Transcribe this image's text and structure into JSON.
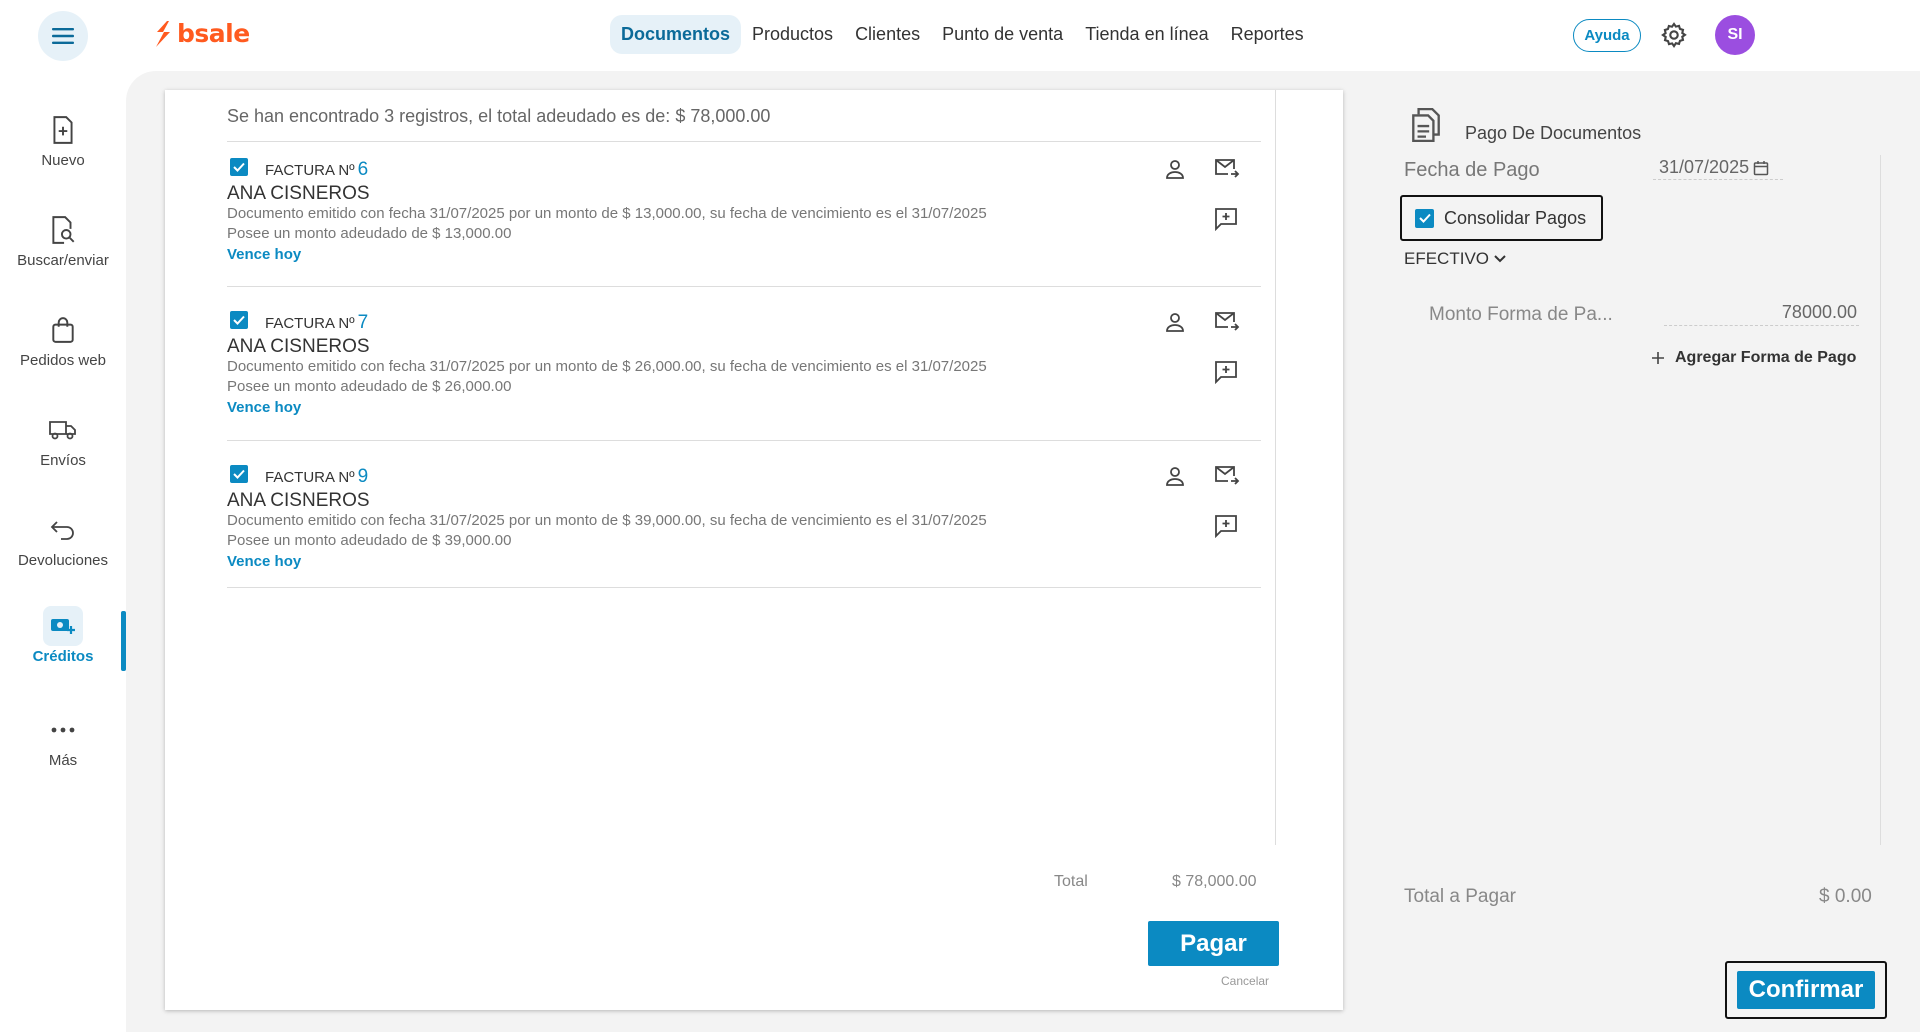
{
  "app": {
    "logo_text": "bsale",
    "brand_color": "#ff5a1f",
    "accent_color": "#0b8ac2"
  },
  "topnav": {
    "items": [
      {
        "label": "Documentos",
        "active": true
      },
      {
        "label": "Productos"
      },
      {
        "label": "Clientes"
      },
      {
        "label": "Punto de venta"
      },
      {
        "label": "Tienda en línea"
      },
      {
        "label": "Reportes"
      }
    ],
    "help_label": "Ayuda",
    "avatar_initials": "SI"
  },
  "sidebar": {
    "items": [
      {
        "label": "Nuevo",
        "icon": "file-plus-icon"
      },
      {
        "label": "Buscar/enviar",
        "icon": "file-search-icon"
      },
      {
        "label": "Pedidos web",
        "icon": "shopping-bag-icon"
      },
      {
        "label": "Envíos",
        "icon": "truck-icon"
      },
      {
        "label": "Devoluciones",
        "icon": "undo-icon"
      },
      {
        "label": "Créditos",
        "icon": "cash-plus-icon",
        "active": true
      },
      {
        "label": "Más",
        "icon": "more-dots-icon"
      }
    ]
  },
  "documents": {
    "summary": "Se han encontrado 3 registros, el total adeudado es de: $ 78,000.00",
    "items": [
      {
        "type": "FACTURA Nº",
        "number": "6",
        "client": "ANA CISNEROS",
        "description": "Documento emitido con fecha 31/07/2025 por un monto de $ 13,000.00, su fecha de vencimiento es el 31/07/2025",
        "owed": "Posee un monto adeudado de $ 13,000.00",
        "due": "Vence hoy",
        "checked": true
      },
      {
        "type": "FACTURA Nº",
        "number": "7",
        "client": "ANA CISNEROS",
        "description": "Documento emitido con fecha 31/07/2025 por un monto de $ 26,000.00, su fecha de vencimiento es el 31/07/2025",
        "owed": "Posee un monto adeudado de $ 26,000.00",
        "due": "Vence hoy",
        "checked": true
      },
      {
        "type": "FACTURA Nº",
        "number": "9",
        "client": "ANA CISNEROS",
        "description": "Documento emitido con fecha 31/07/2025 por un monto de $ 39,000.00, su fecha de vencimiento es el 31/07/2025",
        "owed": "Posee un monto adeudado de $ 39,000.00",
        "due": "Vence hoy",
        "checked": true
      }
    ],
    "total_label": "Total",
    "total_value": "$ 78,000.00",
    "pay_label": "Pagar",
    "cancel_label": "Cancelar"
  },
  "payment": {
    "title": "Pago De Documentos",
    "date_label": "Fecha de Pago",
    "date_value": "31/07/2025",
    "consolidate_label": "Consolidar Pagos",
    "consolidate_checked": true,
    "method": "EFECTIVO",
    "amount_label": "Monto Forma de Pa...",
    "amount_value": "78000.00",
    "add_method_label": "Agregar Forma de Pago",
    "total_label": "Total a Pagar",
    "total_value": "$ 0.00",
    "confirm_label": "Confirmar"
  }
}
